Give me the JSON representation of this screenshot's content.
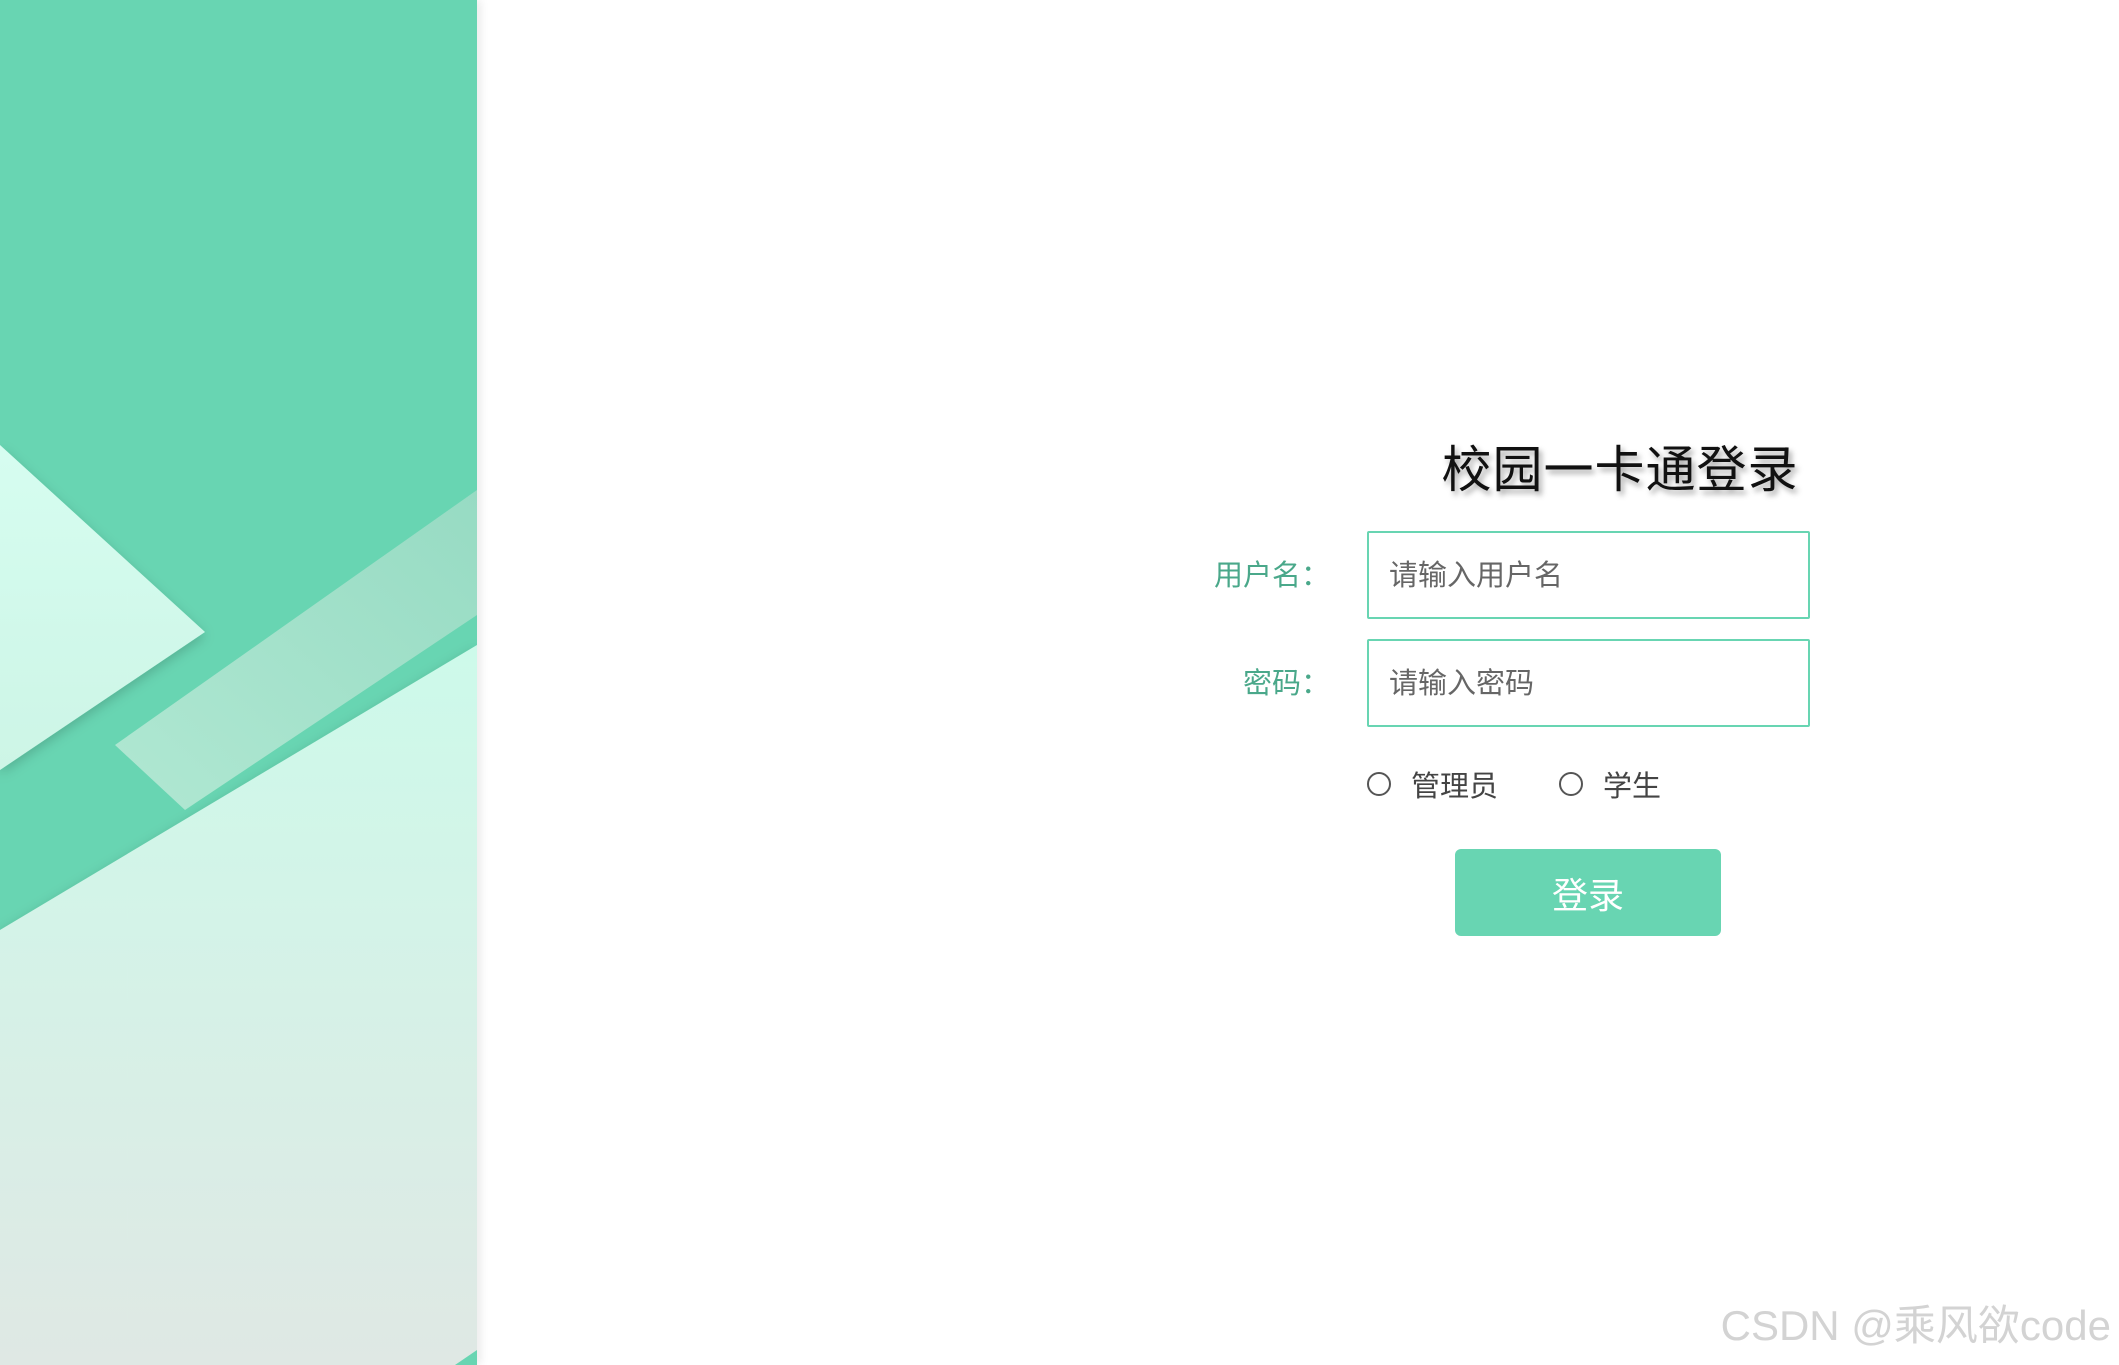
{
  "login": {
    "title": "校园一卡通登录",
    "username_label": "用户名：",
    "username_placeholder": "请输入用户名",
    "password_label": "密码：",
    "password_placeholder": "请输入密码",
    "roles": [
      {
        "label": "管理员",
        "selected": false
      },
      {
        "label": "学生",
        "selected": false
      }
    ],
    "submit_label": "登录"
  },
  "watermark": "CSDN @乘风欲code",
  "colors": {
    "accent": "#68d5b2",
    "label_green": "#4aa88a",
    "panel_light": "#d4f7ea"
  }
}
